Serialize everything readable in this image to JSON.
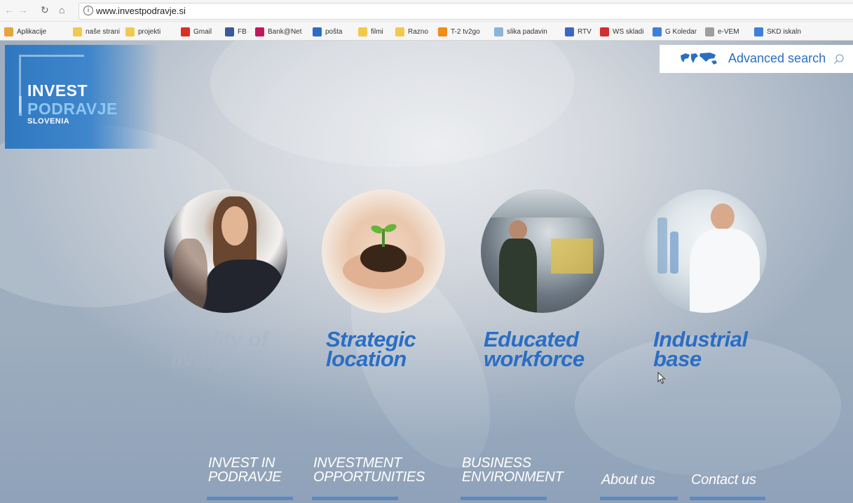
{
  "browser": {
    "url": "www.investpodravje.si",
    "bookmarks": [
      {
        "label": "Aplikacije",
        "icon": "apps-grid-icon",
        "color": "#e8a33a"
      },
      {
        "label": "naše strani",
        "icon": "folder-icon",
        "color": "#f2c94c"
      },
      {
        "label": "projekti",
        "icon": "folder-icon",
        "color": "#f2c94c"
      },
      {
        "label": "Gmail",
        "icon": "gmail-icon",
        "color": "#d93025"
      },
      {
        "label": "FB",
        "icon": "facebook-icon",
        "color": "#3b5998"
      },
      {
        "label": "Bank@Net",
        "icon": "bank-icon",
        "color": "#c2185b"
      },
      {
        "label": "pošta",
        "icon": "mail-icon",
        "color": "#2d6bc6"
      },
      {
        "label": "filmi",
        "icon": "folder-icon",
        "color": "#f2c94c"
      },
      {
        "label": "Razno",
        "icon": "folder-icon",
        "color": "#f2c94c"
      },
      {
        "label": "T-2 tv2go",
        "icon": "tv-icon",
        "color": "#f28c1b"
      },
      {
        "label": "slika padavin",
        "icon": "weather-icon",
        "color": "#8ab4d9"
      },
      {
        "label": "RTV",
        "icon": "rtv-icon",
        "color": "#3a66c4"
      },
      {
        "label": "WS skladi",
        "icon": "ws-icon",
        "color": "#d32f2f"
      },
      {
        "label": "G Koledar",
        "icon": "calendar-icon",
        "color": "#3f7fd8"
      },
      {
        "label": "e-VEM",
        "icon": "document-icon",
        "color": "#9e9e9e"
      },
      {
        "label": "SKD iskaln",
        "icon": "skd-icon",
        "color": "#3f7fd8"
      }
    ]
  },
  "site": {
    "logo": {
      "line1": "INVEST",
      "line2": "PODRAVJE",
      "line3": "SLOVENIA"
    },
    "search": {
      "label": "Advanced search"
    },
    "features": [
      {
        "label_l1": "Quality of",
        "label_l2": "living",
        "photo": "business-woman-photo"
      },
      {
        "label_l1": "Strategic",
        "label_l2": "location",
        "photo": "hands-seedling-photo"
      },
      {
        "label_l1": "Educated",
        "label_l2": "workforce",
        "photo": "factory-worker-photo"
      },
      {
        "label_l1": "Industrial",
        "label_l2": "base",
        "photo": "lab-scientist-photo"
      }
    ],
    "menu": [
      {
        "l1": "INVEST IN",
        "l2": "PODRAVJE"
      },
      {
        "l1": "INVESTMENT",
        "l2": "OPPORTUNITIES"
      },
      {
        "l1": "BUSINESS",
        "l2": "ENVIRONMENT"
      },
      {
        "l1": "About us",
        "l2": ""
      },
      {
        "l1": "Contact us",
        "l2": ""
      }
    ],
    "colors": {
      "brand_blue": "#2a6ec4",
      "menu_bar": "#2e7cc9"
    }
  }
}
